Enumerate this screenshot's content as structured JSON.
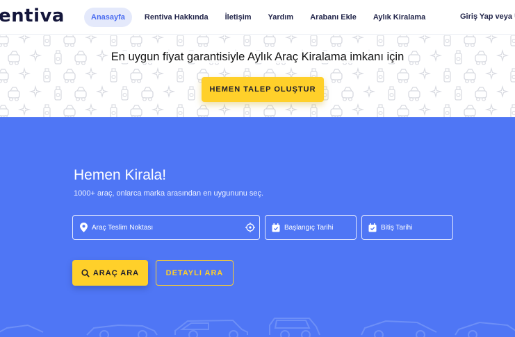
{
  "header": {
    "logo": "entiva",
    "nav": [
      {
        "label": "Anasayfa",
        "active": true
      },
      {
        "label": "Rentiva Hakkında",
        "active": false
      },
      {
        "label": "İletişim",
        "active": false
      },
      {
        "label": "Yardım",
        "active": false
      },
      {
        "label": "Arabanı Ekle",
        "active": false
      },
      {
        "label": "Aylık Kiralama",
        "active": false
      }
    ],
    "login": "Giriş Yap veya Üy"
  },
  "promo": {
    "text": "En uygun fiyat garantisiyle Aylık Araç Kiralama imkanı için",
    "cta": "HEMEN TALEP OLUŞTUR"
  },
  "hero": {
    "title": "Hemen Kirala!",
    "subtitle": "1000+ araç, onlarca marka arasından en uygununu seç.",
    "location_placeholder": "Araç Teslim Noktası",
    "start_placeholder": "Başlangıç Tarihi",
    "end_placeholder": "Bitiş Tarihi",
    "search_button": "ARAÇ ARA",
    "detail_button": "DETAYLI ARA"
  },
  "colors": {
    "brand_blue": "#4f76f5",
    "accent_yellow": "#ffd02a",
    "nav_active_bg": "#e4e9fb"
  },
  "icons": [
    "location-pin-icon",
    "locate-target-icon",
    "calendar-icon",
    "search-icon",
    "car-silhouette-icon",
    "pattern-icon"
  ]
}
